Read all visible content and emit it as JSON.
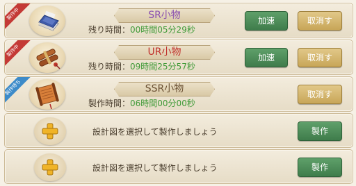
{
  "slots": [
    {
      "status_tag": "製作中",
      "item_icon": "blue-book-icon",
      "name": "SR小物",
      "timer_label": "残り時間：",
      "timer_value": "00時間05分29秒",
      "accelerate_label": "加速",
      "cancel_label": "取消す"
    },
    {
      "status_tag": "製作中",
      "item_icon": "scroll-bundle-icon",
      "name": "UR小物",
      "timer_label": "残り時間：",
      "timer_value": "09時間25分57秒",
      "accelerate_label": "加速",
      "cancel_label": "取消す"
    },
    {
      "status_tag": "製作待ち",
      "item_icon": "open-scroll-icon",
      "name": "SSR小物",
      "timer_label": "製作時間：",
      "timer_value": "06時間00分00秒",
      "cancel_label": "取消す"
    },
    {
      "prompt": "設計図を選択して製作しましょう",
      "make_label": "製作"
    },
    {
      "prompt": "設計図を選択して製作しましょう",
      "make_label": "製作"
    }
  ],
  "colors": {
    "ribbon_active": "#c43a36",
    "ribbon_waiting": "#3d8bc9",
    "timer_value": "#3f9a37",
    "button_green": "#3f7c4b",
    "button_gold": "#c8a658"
  }
}
